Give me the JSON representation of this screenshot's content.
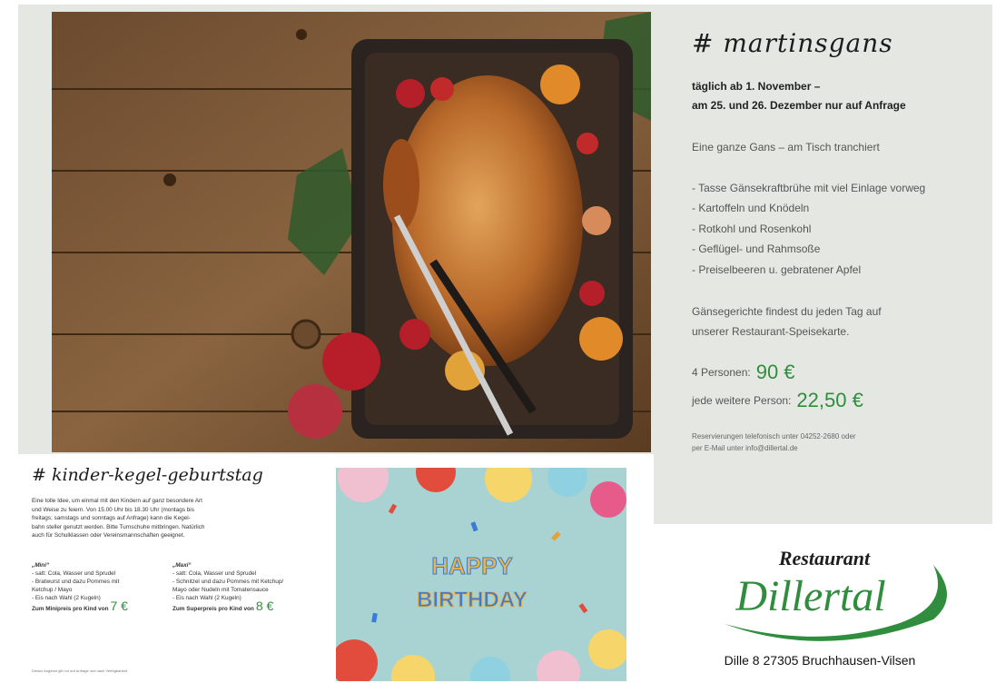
{
  "menu_special": {
    "hashtag": "# martinsgans",
    "date_line": "täglich ab 1. November –",
    "date_note": "am 25. und 26. Dezember nur auf Anfrage",
    "description": "Eine ganze Gans – am Tisch tranchiert",
    "items": [
      "- Tasse Gänsekraftbrühe mit viel Einlage vorweg",
      "- Kartoffeln und Knödeln",
      "- Rotkohl und Rosenkohl",
      "- Geflügel- und Rahmsoße",
      "- Preiselbeeren u. gebratener Apfel"
    ],
    "note_line1": "Gänsegerichte findest du jeden Tag auf",
    "note_line2": "unserer Restaurant-Speisekarte.",
    "price_label_1": "4 Personen:",
    "price_value_1": "90 €",
    "price_label_2": "jede weitere Person:",
    "price_value_2": "22,50 €",
    "reservation_line1": "Reservierungen telefonisch unter 04252-2680 oder",
    "reservation_line2": "per E-Mail unter info@dillertal.de"
  },
  "party_section": {
    "hashtag": "# kinder-kegel-geburtstag",
    "intro_line1": "Eine tolle Idee, um einmal mit den Kindern auf ganz besondere Art",
    "intro_line2": "und Weise zu feiern. Von 15.00 Uhr bis 18.30 Uhr (montags bis",
    "intro_line3": "freitags; samstags und sonntags auf Anfrage) kann die Kegel-",
    "intro_line4": "bahn steller genutzt werden. Bitte Turnschuhe mitbringen. Natürlich",
    "intro_line5": "auch für Schulklassen oder Vereinsmannschaften geeignet.",
    "menu1": {
      "title": "„Mini“",
      "items": [
        "- satt: Cola, Wasser und Sprudel",
        "- Bratwurst und dazu Pommes mit",
        "  Ketchup / Mayo",
        "- Eis nach Wahl (2 Kugeln)"
      ],
      "price_label": "Zum Minipreis pro Kind von",
      "price_value": "7 €"
    },
    "menu2": {
      "title": "„Maxi“",
      "items": [
        "- satt: Cola, Wasser und Sprudel",
        "- Schnitzel und dazu Pommes mit Ketchup/",
        "  Mayo oder Nudeln mit Tomatensauce",
        "- Eis nach Wahl (2 Kugeln)"
      ],
      "price_label": "Zum Superpreis pro Kind von",
      "price_value": "8 €"
    },
    "fine_print": "Dieses Angebot gilt nur auf Anfrage und nach Verfügbarkeit",
    "birthday_line1": "HAPPY",
    "birthday_line2": "BIRTHDAY"
  },
  "restaurant": {
    "logo_top": "Restaurant",
    "logo_main": "Dillertal",
    "address": "Dille 8  27305 Bruchhausen-Vilsen"
  },
  "colors": {
    "accent_green": "#2f8d3d",
    "panel_bg": "#e5e8e2"
  }
}
